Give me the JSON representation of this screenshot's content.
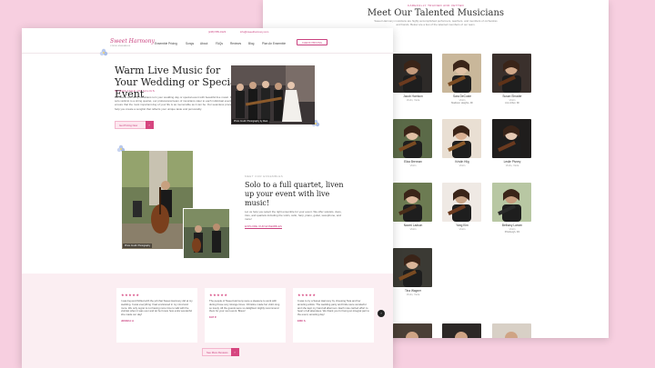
{
  "back_page": {
    "eyebrow": "CAREFULLY TRAINED AND VETTED",
    "title": "Meet Our Talented Musicians",
    "intro": "Sweet Harmony musicians are highly accomplished performers, teachers, and members of orchestras and bands. Below are a few of the talented members of our team.",
    "musicians": [
      {
        "name": "Jacob Harrison",
        "role": "Violin, Viola",
        "location": ""
      },
      {
        "name": "Sara DeCoste",
        "role": "Violin",
        "location": "Madison Heights, MI"
      },
      {
        "name": "Susan Shrader",
        "role": "Violin",
        "location": "Ann Arbor, MI"
      },
      {
        "name": "Eliza Brennan",
        "role": "Violin",
        "location": ""
      },
      {
        "name": "Kristin Hiig",
        "role": "Violin",
        "location": ""
      },
      {
        "name": "Leslie Pivney",
        "role": "Violin, Viola",
        "location": ""
      },
      {
        "name": "Naomi Ladson",
        "role": "Violin",
        "location": ""
      },
      {
        "name": "Yang Kim",
        "role": "Violin",
        "location": ""
      },
      {
        "name": "Bethany Larsen",
        "role": "Violin",
        "location": "Pittsburgh, PA"
      },
      {
        "name": "Tina Wagner",
        "role": "Violin, Viola",
        "location": ""
      }
    ]
  },
  "front_page": {
    "topbar": {
      "phone": "(248) 555-0123",
      "email": "info@sweetharmony.com"
    },
    "logo": "Sweet Harmony",
    "logo_sub": "STRING ENSEMBLES",
    "nav": [
      "Ensemble Pricing",
      "Songs",
      "About",
      "FAQs",
      "Reviews",
      "Blog",
      "Plan An Ensemble"
    ],
    "nav_button": "CHECK PRICING",
    "hero": {
      "title": "Warm Live Music for Your Wedding or Special Event",
      "eyebrow": "SHOWCASED ON SALIUS",
      "text": "Let Sweet Harmony musicians turn your wedding day or special event with beautiful live music. From a solo violinist to a string quartet, our professional team of musicians cater to each individual event to ensure that the most important day of your life is as memorable as it can be. Our seamless process can help you create a songlist that reflects your unique taste and personality.",
      "button": "Get Pricing Now",
      "photo_caption": "Photo Credit: Photography by Mark"
    },
    "section2": {
      "eyebrow": "MEET OUR ENSEMBLES",
      "title": "Solo to a full quartet, liven up your event with live music!",
      "text": "Let us help you select the right ensemble for your event. We offer soloists, duos, trios, and quartets including the violin, cello, harp, piano, guitar, saxophone, and more!",
      "link": "EXPLORE OUR ENSEMBLES",
      "photo_caption": "Photo Credit: Photography"
    },
    "testimonials": [
      {
        "stars": "★★★★★",
        "text": "I was beyond thrilled with the job that Sweet Harmony did at my wedding. It was everything I had envisioned in my mind and more. We only regret is not having more time to talk with the violinist when it was over and let her know how extra wonderful she made our day!",
        "name": "JESSICA H."
      },
      {
        "stars": "★★★★★",
        "text": "The people of Sweet Harmony were a pleasure to work with during those very strange times. Christine made her violin sing so lovely. All the guests were so delighted. Highly recommend them for your next event. Bravo!",
        "name": "KAT P."
      },
      {
        "stars": "★★★★★",
        "text": "It was to try a Sweet Harmony by choosing Tara and her amazing artists. The wedding party and bride were wonderful and she kept my hand all afternoon. Each note carried effort to heart of all attendees. We thank you for being an integral part to the event, amazing day!",
        "name": "ERIC S."
      }
    ],
    "reviews_button": "See More Reviews"
  }
}
